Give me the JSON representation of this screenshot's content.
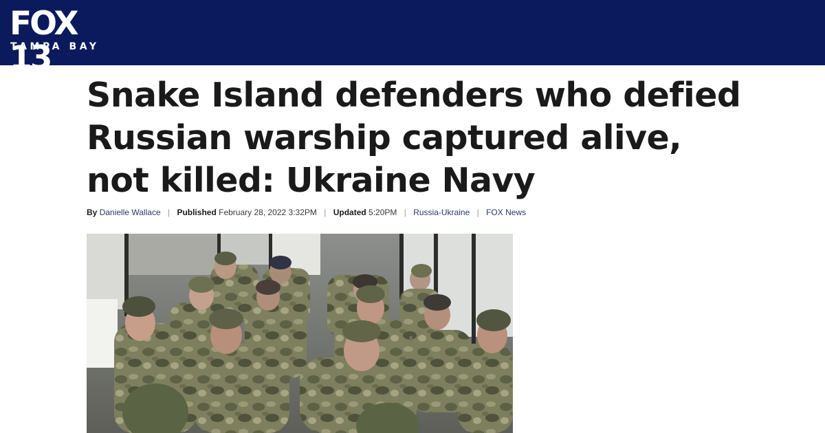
{
  "brand": {
    "logo_main": "FOX 13",
    "logo_sub": "TAMPA BAY",
    "header_color": "#0a1a5c"
  },
  "article": {
    "headline": "Snake Island defenders who defied Russian warship captured alive, not killed: Ukraine Navy",
    "byline": {
      "by_label": "By",
      "author": "Danielle Wallace",
      "published_label": "Published",
      "published": "February 28, 2022 3:32PM",
      "updated_label": "Updated",
      "updated": "5:20PM",
      "category": "Russia-Ukraine",
      "source": "FOX News",
      "separator": "|"
    },
    "image": {
      "subject": "soldiers-in-camouflage-seated-on-bus"
    }
  }
}
